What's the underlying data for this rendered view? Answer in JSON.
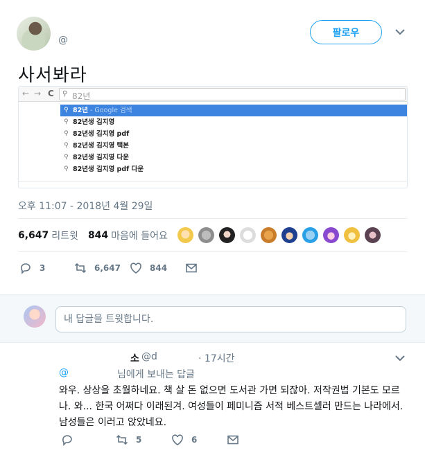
{
  "tweet": {
    "handle": "@",
    "follow_label": "팔로우",
    "text": "사서봐라",
    "timestamp": "오후 11:07 - 2018년 4월 29일",
    "retweets_count": "6,647",
    "retweets_label": "리트윗",
    "likes_count": "844",
    "likes_label": "마음에 들어요",
    "actions": {
      "reply_count": "3",
      "retweet_count": "6,647",
      "like_count": "844"
    }
  },
  "screenshot": {
    "nav_back": "←",
    "nav_forward": "→",
    "nav_reload": "C",
    "query": "82년",
    "suggestions": [
      {
        "main": "82년",
        "suffix": " - Google 검색",
        "selected": true
      },
      {
        "main": "82년생 김지영",
        "suffix": "",
        "selected": false
      },
      {
        "main": "82년생 김지영 pdf",
        "suffix": "",
        "selected": false
      },
      {
        "main": "82년생 김지영 택본",
        "suffix": "",
        "selected": false
      },
      {
        "main": "82년생 김지영 다운",
        "suffix": "",
        "selected": false
      },
      {
        "main": "82년생 김지영 pdf 다운",
        "suffix": "",
        "selected": false
      }
    ]
  },
  "reply_box": {
    "placeholder": "내 답글을 트윗합니다."
  },
  "reply": {
    "name": "소",
    "handle": "@d",
    "time": "· 17시간",
    "to_at": "@",
    "to_text": "님에게 보내는 답글",
    "body": "와우. 상상을 초월하네요. 책 살 돈 없으면 도서관 가면 되잖아. 저작권법 기본도 모르나. 와... 한국 어쩌다 이래된겨. 여성들이 페미니즘 서적 베스트셀러 만드는 나라에서. 남성들은 이러고 앉았네요.",
    "actions": {
      "reply_count": "",
      "retweet_count": "5",
      "like_count": "6"
    }
  },
  "colors": {
    "accent": "#1da1f2",
    "muted": "#657786",
    "omnibox_selected": "#3d84e0"
  }
}
